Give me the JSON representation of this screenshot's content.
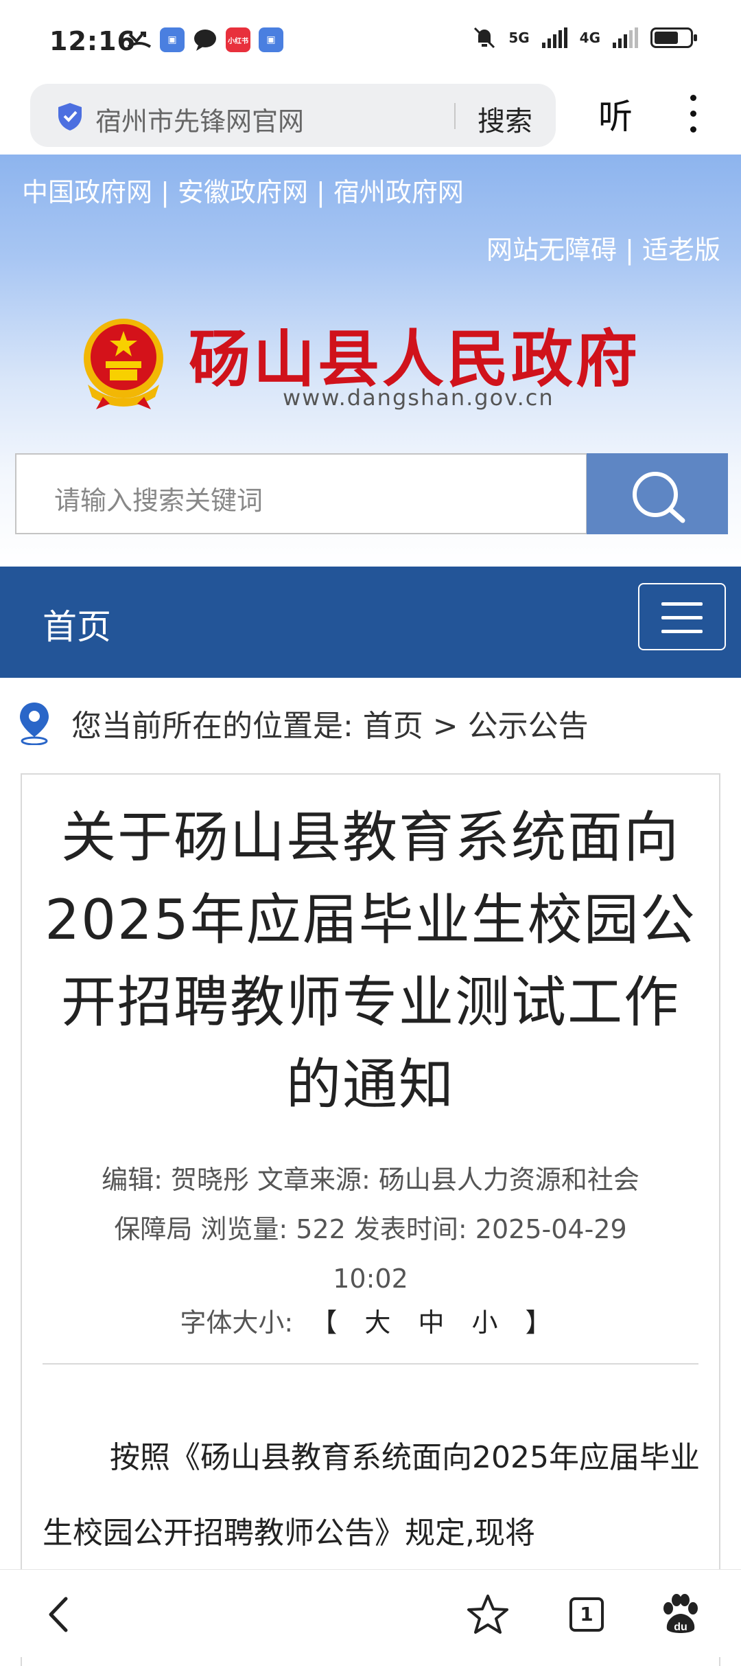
{
  "status_bar": {
    "time": "12:16",
    "network_1": "5G",
    "network_2": "4G",
    "app_icon_label": "小红书"
  },
  "browser": {
    "address_text": "宿州市先锋网官网",
    "search_button": "搜索",
    "listen_button": "听"
  },
  "header": {
    "gov_links": "中国政府网 | 安徽政府网 | 宿州政府网",
    "access_links": "网站无障碍 | 适老版",
    "site_title": "砀山县人民政府",
    "site_url": "www.dangshan.gov.cn",
    "search_placeholder": "请输入搜索关键词"
  },
  "nav": {
    "home": "首页"
  },
  "breadcrumb": {
    "text": "您当前所在的位置是:  首页 > 公示公告"
  },
  "article": {
    "title": "关于砀山县教育系统面向2025年应届毕业生校园公开招聘教师专业测试工作的通知",
    "meta_line1": "编辑: 贺晓彤    文章来源:  砀山县人力资源和社会",
    "meta_line2": "保障局  浏览量: 522  发表时间: 2025-04-29",
    "meta_line3": "10:02",
    "font_size_label": "字体大小:",
    "font_size_open": "【",
    "font_size_large": "大",
    "font_size_medium": "中",
    "font_size_small": "小",
    "font_size_close": "】",
    "paragraph": "按照《砀山县教育系统面向2025年应届毕业生校园公开招聘教师公告》规定,现将"
  },
  "bottom_bar": {
    "tab_count": "1"
  },
  "colors": {
    "nav_blue": "#235598",
    "search_btn": "#5e86c4",
    "title_red": "#d0121b"
  }
}
